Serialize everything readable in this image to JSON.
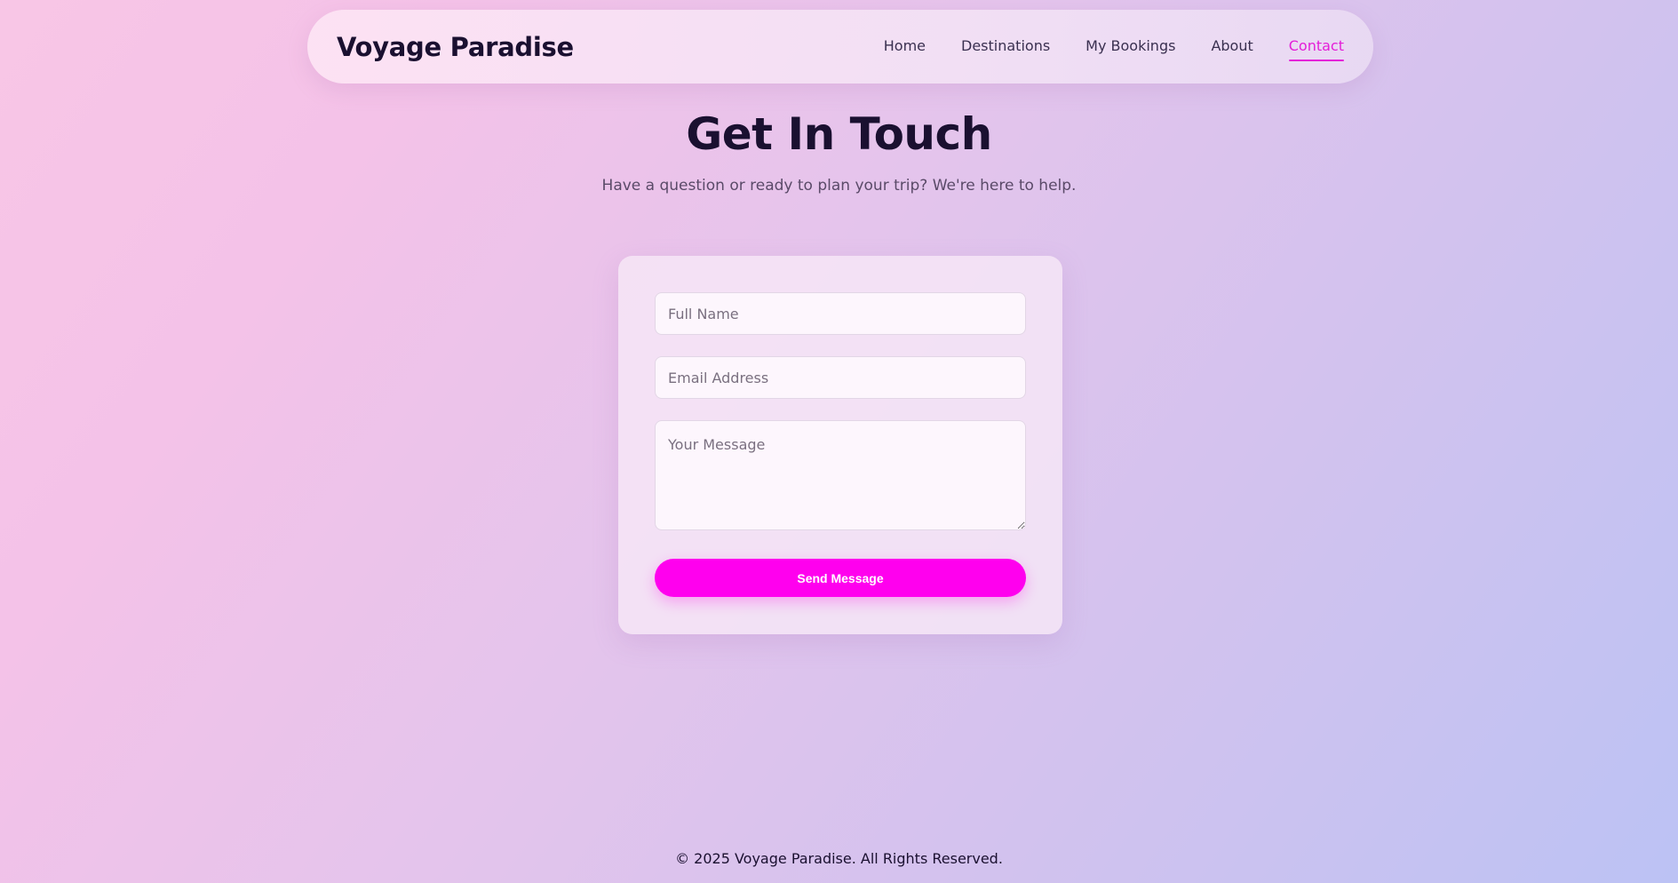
{
  "header": {
    "brand": "Voyage Paradise",
    "nav": [
      {
        "label": "Home",
        "active": false
      },
      {
        "label": "Destinations",
        "active": false
      },
      {
        "label": "My Bookings",
        "active": false
      },
      {
        "label": "About",
        "active": false
      },
      {
        "label": "Contact",
        "active": true
      }
    ]
  },
  "hero": {
    "title": "Get In Touch",
    "subtitle": "Have a question or ready to plan your trip? We're here to help."
  },
  "form": {
    "name_placeholder": "Full Name",
    "name_value": "",
    "email_placeholder": "Email Address",
    "email_value": "",
    "message_placeholder": "Your Message",
    "message_value": "",
    "submit_label": "Send Message"
  },
  "footer": {
    "text": "© 2025 Voyage Paradise. All Rights Reserved."
  },
  "colors": {
    "accent": "#ff00ee",
    "active_link": "#e41fd8",
    "heading": "#1a1030"
  }
}
